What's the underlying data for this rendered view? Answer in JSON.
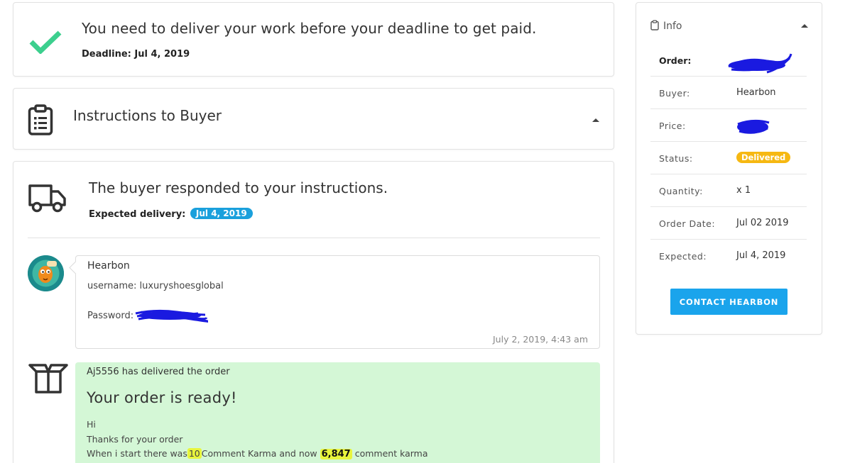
{
  "deadline": {
    "message": "You need to deliver your work before your deadline to get paid.",
    "label": "Deadline:",
    "date": "Jul 4, 2019",
    "icon": "checkmark-icon",
    "accent": "#3ccf8e"
  },
  "instructions": {
    "title": "Instructions to Buyer",
    "icon": "clipboard-icon"
  },
  "activity": {
    "response_title": "The buyer responded to your instructions.",
    "expected_label": "Expected delivery:",
    "expected_date": "Jul 4, 2019",
    "badge_color": "#1aa0dc",
    "message": {
      "author": "Hearbon",
      "line1": "username: luxuryshoesglobal",
      "line2": "Password:",
      "timestamp": "July 2, 2019, 4:43 am"
    },
    "delivery": {
      "by_text": "Aj5556 has delivered the order",
      "headline": "Your order is ready!",
      "greeting": "Hi",
      "thanks": "Thanks for your order",
      "karma_part1": "When i start there was",
      "karma_before": "10",
      "karma_part2": "Comment Karma and now",
      "karma_after": "6,847",
      "karma_part3": "comment karma",
      "bg_color": "#d4f7d6"
    }
  },
  "info": {
    "title": "Info",
    "rows": [
      {
        "label": "Order:",
        "value": ""
      },
      {
        "label": "Buyer:",
        "value": "Hearbon"
      },
      {
        "label": "Price:",
        "value": ""
      },
      {
        "label": "Status:",
        "value": "Delivered"
      },
      {
        "label": "Quantity:",
        "value": "x 1"
      },
      {
        "label": "Order Date:",
        "value": "Jul 02 2019"
      },
      {
        "label": "Expected:",
        "value": "Jul 4, 2019"
      }
    ],
    "status_color": "#f6b812",
    "contact_button": "CONTACT HEARBON",
    "button_color": "#1aa4ec"
  }
}
